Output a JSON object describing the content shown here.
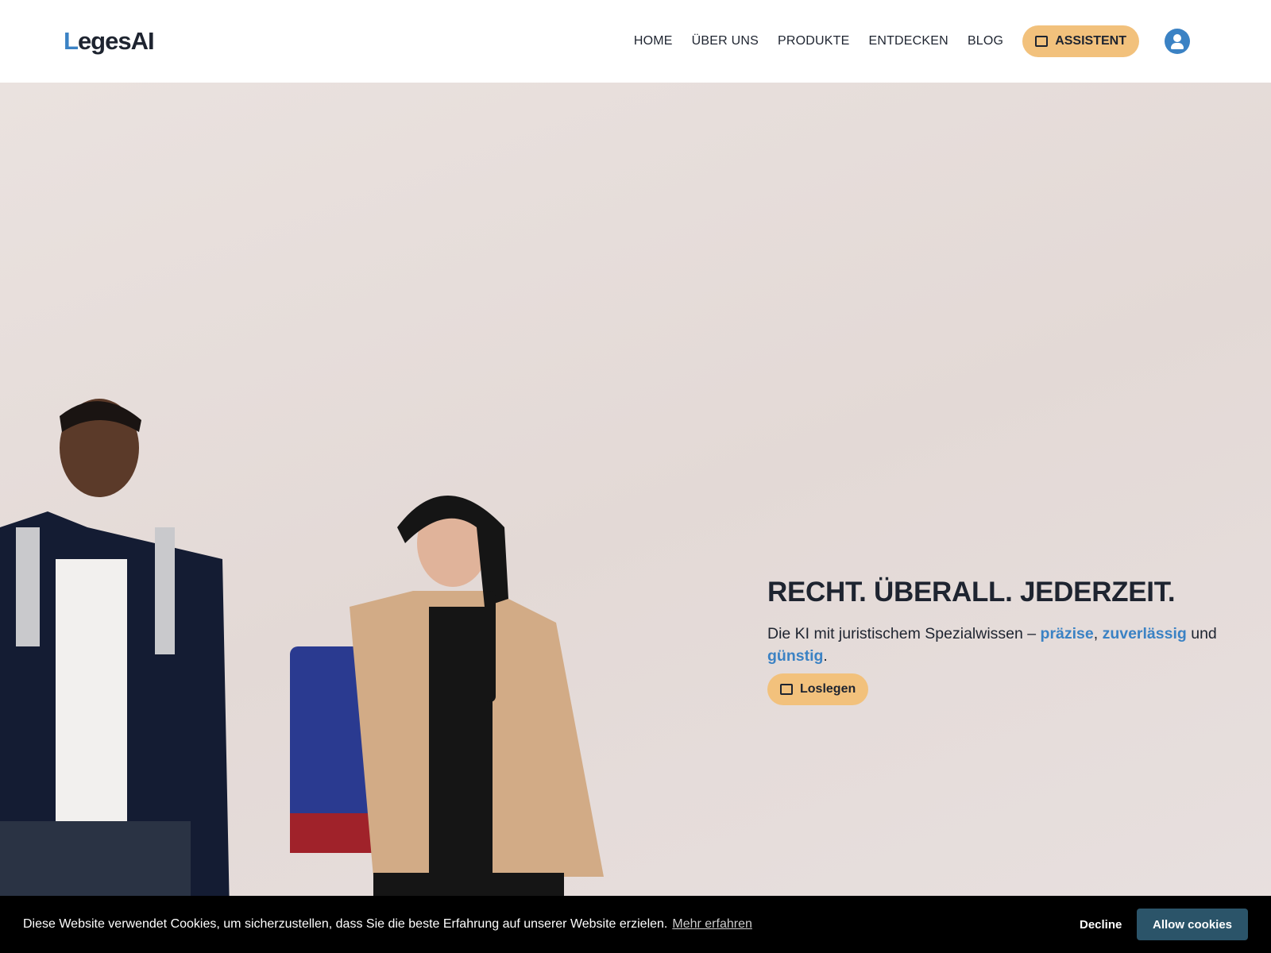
{
  "header": {
    "logo_text": "LegesAI",
    "nav": [
      {
        "label": "HOME"
      },
      {
        "label": "ÜBER UNS"
      },
      {
        "label": "PRODUKTE"
      },
      {
        "label": "ENTDECKEN"
      },
      {
        "label": "BLOG"
      }
    ],
    "assistant_label": "ASSISTENT",
    "assistant_icon": "chat-sparkle-icon",
    "avatar_icon": "user-icon"
  },
  "hero": {
    "title": "RECHT. ÜBERALL. JEDERZEIT.",
    "subtitle_start": "Die KI mit juristischem Spezialwissen – ",
    "highlight1": "präzise",
    "sep1": ", ",
    "highlight2": "zuverlässig",
    "sep2": " und ",
    "highlight3": "günstig",
    "end": ".",
    "cta_label": "Loslegen"
  },
  "cookie": {
    "text": "Diese Website verwendet Cookies, um sicherzustellen, dass Sie die beste Erfahrung auf unserer Website erzielen.",
    "learn_more": "Mehr erfahren",
    "decline": "Decline",
    "allow": "Allow cookies"
  },
  "colors": {
    "accent": "#3b82c4",
    "button": "#f2c17c",
    "cookie_allow": "#2b5469"
  }
}
